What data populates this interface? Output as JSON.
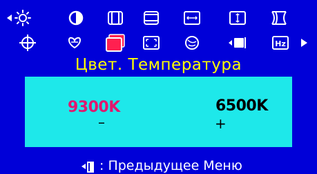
{
  "menu": {
    "icons_row1": [
      {
        "name": "brightness-icon"
      },
      {
        "name": "contrast-icon"
      },
      {
        "name": "h-position-icon"
      },
      {
        "name": "v-position-icon"
      },
      {
        "name": "h-size-icon"
      },
      {
        "name": "v-size-icon"
      },
      {
        "name": "pincushion-icon"
      }
    ],
    "icons_row2": [
      {
        "name": "language-icon"
      },
      {
        "name": "recall-icon"
      },
      {
        "name": "color-temperature-icon",
        "selected": true
      },
      {
        "name": "zoom-icon"
      },
      {
        "name": "degauss-icon"
      },
      {
        "name": "input-icon"
      },
      {
        "name": "frequency-icon"
      }
    ],
    "selected_color": "#ff2050"
  },
  "title": "Цвет. Температура",
  "options": {
    "left_label": "9300K",
    "left_sign": "–",
    "right_label": "6500K",
    "right_sign": "+",
    "selected": "9300K",
    "selected_color": "#e0186e",
    "panel_color": "#1ee8ea"
  },
  "footer": {
    "text": ": Предыдущее Меню",
    "icon": "exit-door-icon"
  },
  "colors": {
    "background": "#0000d8",
    "title": "#ffff00",
    "text": "#ffffff"
  }
}
